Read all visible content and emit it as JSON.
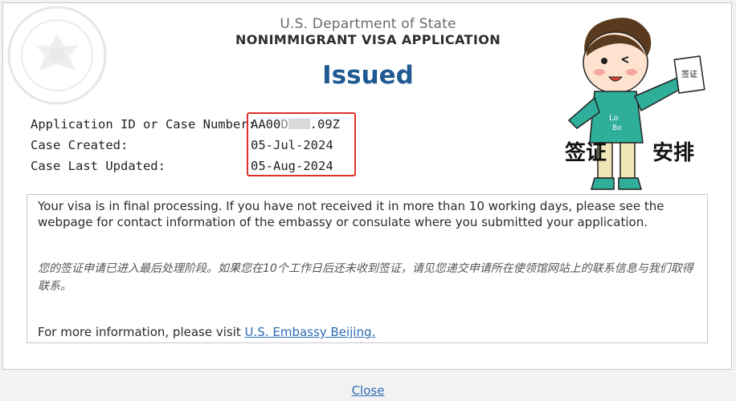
{
  "header": {
    "department": "U.S. Department of State",
    "title": "NONIMMIGRANT VISA APPLICATION",
    "status": "Issued"
  },
  "fields": [
    {
      "label": "Application ID or Case Number:",
      "value_start": "AA00",
      "value_partial": "D",
      "value_end": ".09Z"
    },
    {
      "label": "Case Created:",
      "value": "05-Jul-2024"
    },
    {
      "label": "Case Last Updated:",
      "value": "05-Aug-2024"
    }
  ],
  "message": {
    "en": "Your visa is in final processing. If you have not received it in more than 10 working days, please see the webpage for contact information of the embassy or consulate where you submitted your application.",
    "zh": "您的签证申请已进入最后处理阶段。如果您在10个工作日后还未收到签证，请见您递交申请所在使领馆网站上的联系信息与我们取得联系。",
    "more_prefix": "For more information, please visit ",
    "link_text": "U.S. Embassy Beijing."
  },
  "footer": {
    "close_label": "Close"
  },
  "sticker": {
    "left_text": "签证",
    "right_text": "安排",
    "card_text": "签证"
  },
  "colors": {
    "status": "#1f5a92",
    "link": "#2b6cb0",
    "highlight": "#e0322c",
    "hoodie": "#2fae9a"
  }
}
